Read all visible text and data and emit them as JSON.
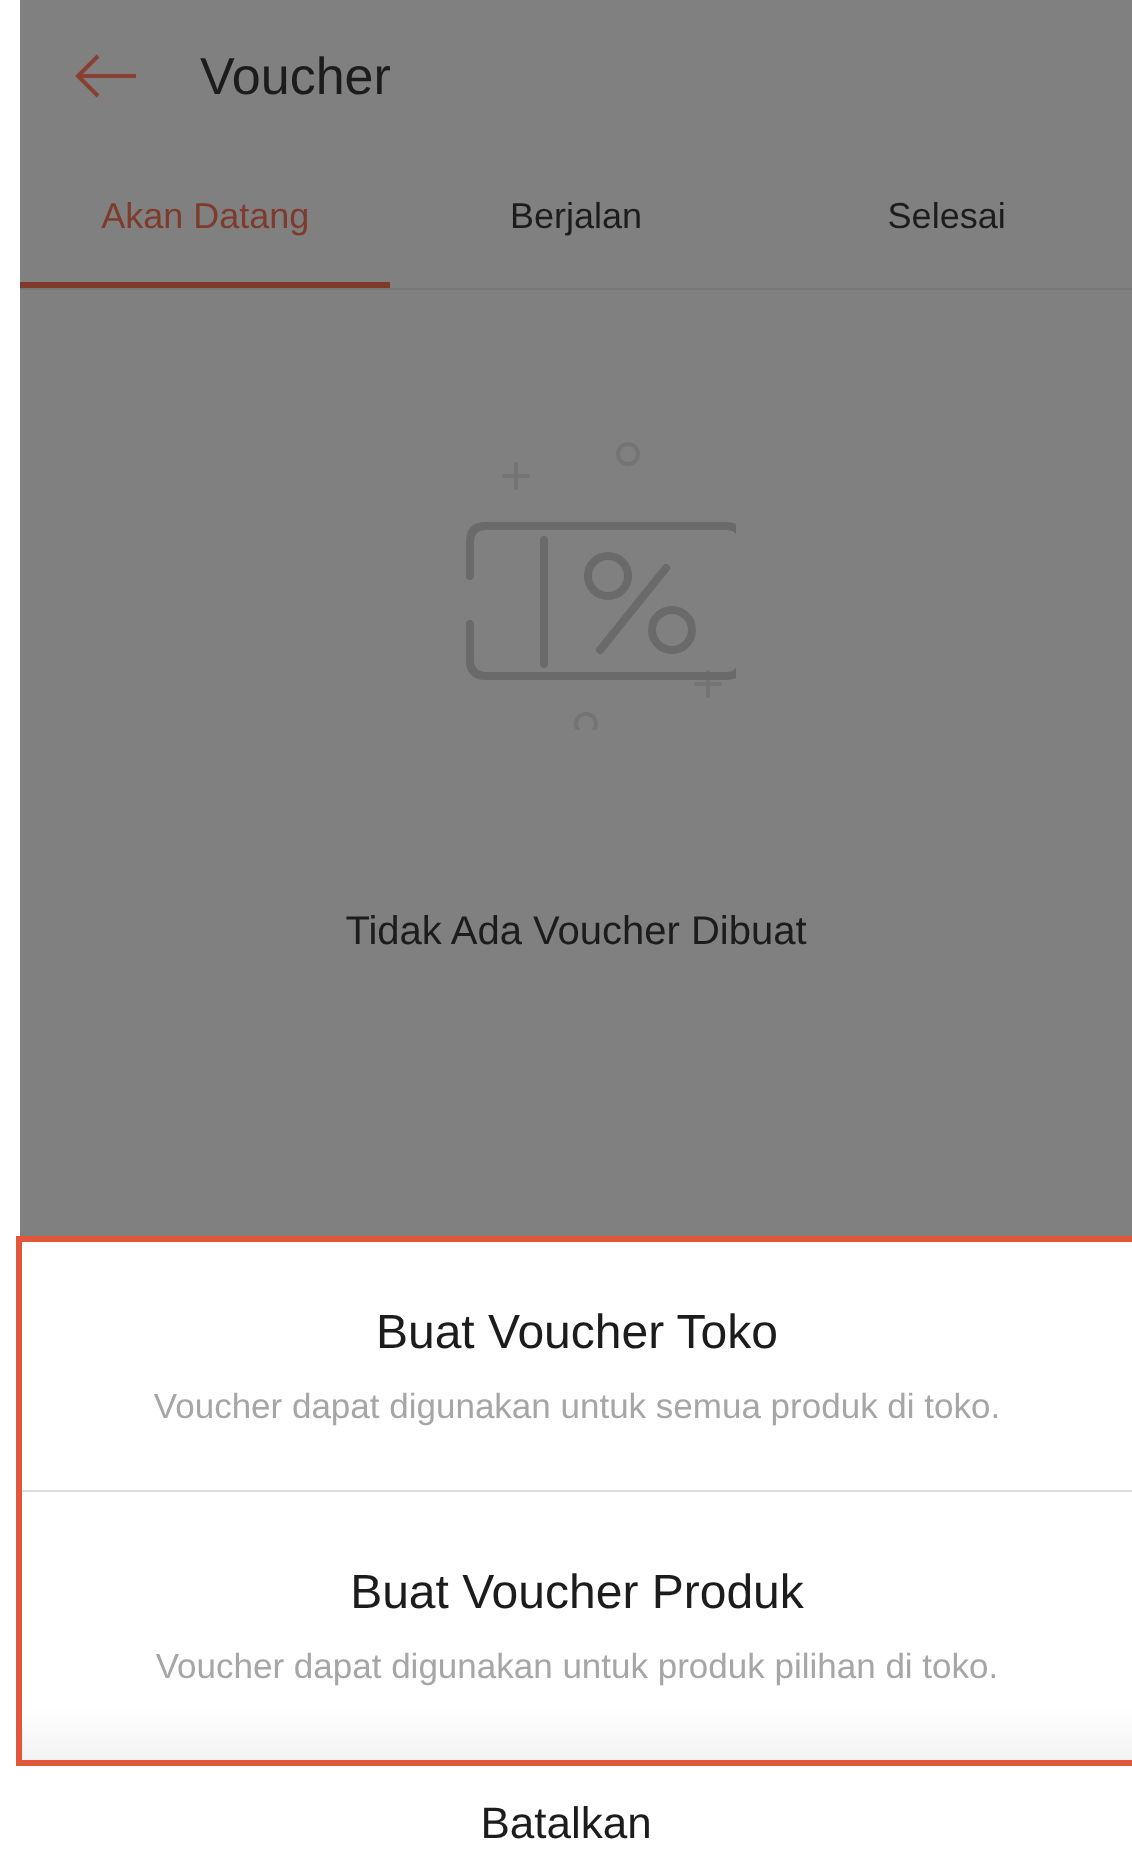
{
  "header": {
    "title": "Voucher"
  },
  "tabs": [
    {
      "label": "Akan Datang",
      "selected": true
    },
    {
      "label": "Berjalan",
      "selected": false
    },
    {
      "label": "Selesai",
      "selected": false
    }
  ],
  "empty_state": {
    "message": "Tidak Ada Voucher Dibuat"
  },
  "action_sheet": {
    "options": [
      {
        "title": "Buat Voucher Toko",
        "description": "Voucher dapat digunakan untuk semua produk di toko."
      },
      {
        "title": "Buat Voucher Produk",
        "description": "Voucher dapat digunakan untuk produk pilihan di toko."
      }
    ],
    "cancel": "Batalkan"
  }
}
